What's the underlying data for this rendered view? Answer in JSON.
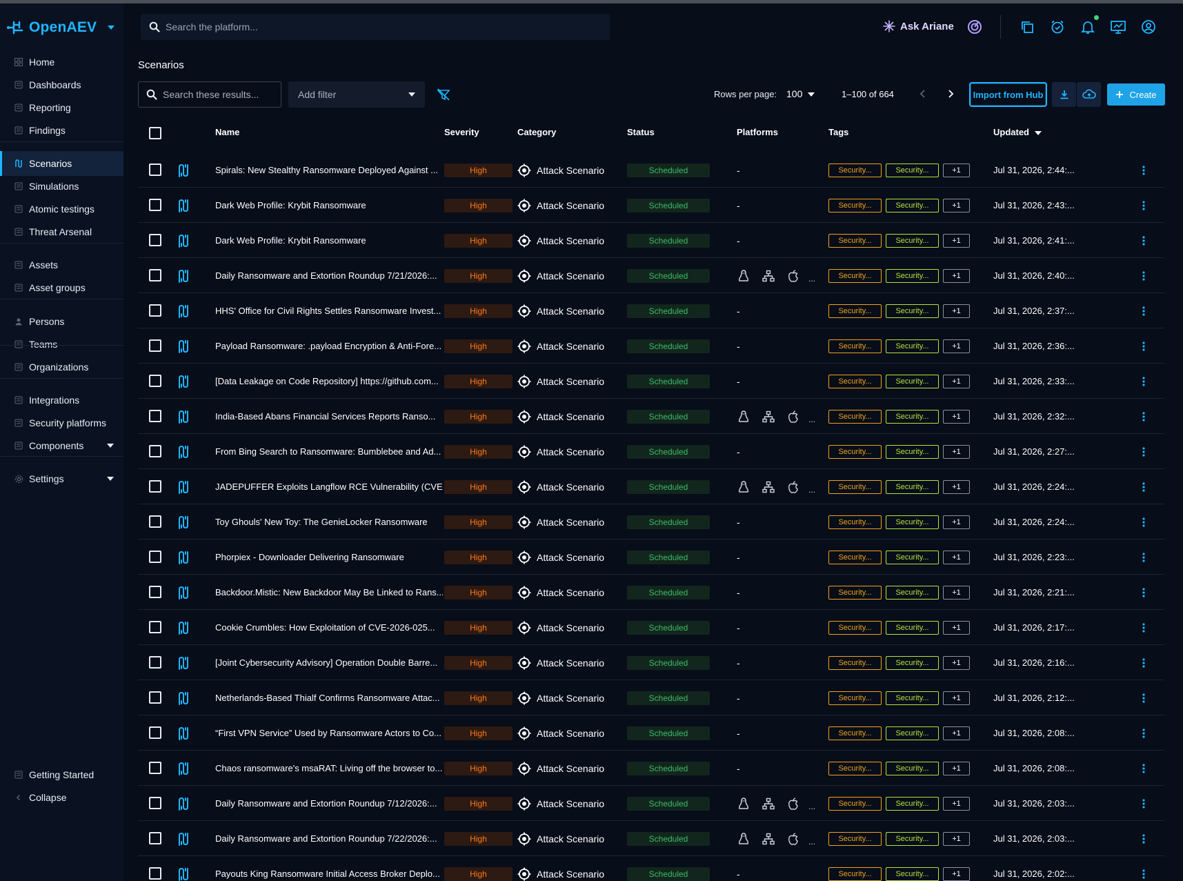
{
  "app": {
    "brand": "OpenAEV",
    "search_placeholder": "Search the platform...",
    "ask_ariane": "Ask Ariane"
  },
  "sidebar": {
    "items": [
      {
        "id": "home",
        "label": "Home",
        "icon": "home-icon"
      },
      {
        "id": "dashboards",
        "label": "Dashboards",
        "icon": "dashboard-icon"
      },
      {
        "id": "reporting",
        "label": "Reporting",
        "icon": "report-icon"
      },
      {
        "id": "findings",
        "label": "Findings",
        "icon": "findings-icon"
      },
      {
        "id": "scenarios",
        "label": "Scenarios",
        "icon": "scenario-icon",
        "active": true
      },
      {
        "id": "simulations",
        "label": "Simulations",
        "icon": "simulation-icon"
      },
      {
        "id": "atomic-testings",
        "label": "Atomic testings",
        "icon": "atomic-icon"
      },
      {
        "id": "threat-arsenal",
        "label": "Threat Arsenal",
        "icon": "arsenal-icon"
      },
      {
        "id": "assets",
        "label": "Assets",
        "icon": "assets-icon"
      },
      {
        "id": "asset-groups",
        "label": "Asset groups",
        "icon": "asset-groups-icon"
      },
      {
        "id": "persons",
        "label": "Persons",
        "icon": "person-icon"
      },
      {
        "id": "teams",
        "label": "Teams",
        "icon": "teams-icon"
      },
      {
        "id": "organizations",
        "label": "Organizations",
        "icon": "organization-icon"
      },
      {
        "id": "integrations",
        "label": "Integrations",
        "icon": "integrations-icon"
      },
      {
        "id": "security-platforms",
        "label": "Security platforms",
        "icon": "security-platform-icon"
      },
      {
        "id": "components",
        "label": "Components",
        "icon": "components-icon"
      },
      {
        "id": "settings",
        "label": "Settings",
        "icon": "settings-icon"
      },
      {
        "id": "getting-started",
        "label": "Getting Started",
        "icon": "rocket-icon"
      },
      {
        "id": "collapse",
        "label": "Collapse",
        "icon": "chevron-left-icon"
      }
    ]
  },
  "main": {
    "title": "Scenarios",
    "search_placeholder": "Search these results...",
    "add_filter": "Add filter",
    "rows_per_page_label": "Rows per page:",
    "rows_per_page": "100",
    "range": "1–100 of 664",
    "import_hub": "Import from Hub",
    "create": "Create"
  },
  "table": {
    "headers": {
      "name": "Name",
      "severity": "Severity",
      "category": "Category",
      "status": "Status",
      "platforms": "Platforms",
      "tags": "Tags",
      "updated": "Updated"
    },
    "tag_labels": {
      "tag1": "Security...",
      "tag2": "Security...",
      "more": "+1"
    },
    "rows": [
      {
        "name": "Spirals: New Stealthy Ransomware Deployed Against ...",
        "severity": "High",
        "category": "Attack Scenario",
        "status": "Scheduled",
        "platforms": "-",
        "updated": "Jul 31, 2026, 2:44:..."
      },
      {
        "name": "Dark Web Profile: Krybit Ransomware",
        "severity": "High",
        "category": "Attack Scenario",
        "status": "Scheduled",
        "platforms": "-",
        "updated": "Jul 31, 2026, 2:43:..."
      },
      {
        "name": "Dark Web Profile: Krybit Ransomware",
        "severity": "High",
        "category": "Attack Scenario",
        "status": "Scheduled",
        "platforms": "-",
        "updated": "Jul 31, 2026, 2:41:..."
      },
      {
        "name": "Daily Ransomware and Extortion Roundup 7/21/2026:...",
        "severity": "High",
        "category": "Attack Scenario",
        "status": "Scheduled",
        "platforms": "icons",
        "updated": "Jul 31, 2026, 2:40:..."
      },
      {
        "name": "HHS' Office for Civil Rights Settles Ransomware Invest...",
        "severity": "High",
        "category": "Attack Scenario",
        "status": "Scheduled",
        "platforms": "-",
        "updated": "Jul 31, 2026, 2:37:..."
      },
      {
        "name": "Payload Ransomware: .payload Encryption & Anti-Fore...",
        "severity": "High",
        "category": "Attack Scenario",
        "status": "Scheduled",
        "platforms": "-",
        "updated": "Jul 31, 2026, 2:36:..."
      },
      {
        "name": "[Data Leakage on Code Repository] https://github.com...",
        "severity": "High",
        "category": "Attack Scenario",
        "status": "Scheduled",
        "platforms": "-",
        "updated": "Jul 31, 2026, 2:33:..."
      },
      {
        "name": "India-Based Abans Financial Services Reports Ranso...",
        "severity": "High",
        "category": "Attack Scenario",
        "status": "Scheduled",
        "platforms": "icons",
        "updated": "Jul 31, 2026, 2:32:..."
      },
      {
        "name": "From Bing Search to Ransomware: Bumblebee and Ad...",
        "severity": "High",
        "category": "Attack Scenario",
        "status": "Scheduled",
        "platforms": "-",
        "updated": "Jul 31, 2026, 2:27:..."
      },
      {
        "name": "JADEPUFFER Exploits Langflow RCE Vulnerability (CVE...",
        "severity": "High",
        "category": "Attack Scenario",
        "status": "Scheduled",
        "platforms": "icons",
        "updated": "Jul 31, 2026, 2:24:..."
      },
      {
        "name": "Toy Ghouls' New Toy: The GenieLocker Ransomware",
        "severity": "High",
        "category": "Attack Scenario",
        "status": "Scheduled",
        "platforms": "-",
        "updated": "Jul 31, 2026, 2:24:..."
      },
      {
        "name": "Phorpiex - Downloader Delivering Ransomware",
        "severity": "High",
        "category": "Attack Scenario",
        "status": "Scheduled",
        "platforms": "-",
        "updated": "Jul 31, 2026, 2:23:..."
      },
      {
        "name": "Backdoor.Mistic: New Backdoor May Be Linked to Rans...",
        "severity": "High",
        "category": "Attack Scenario",
        "status": "Scheduled",
        "platforms": "-",
        "updated": "Jul 31, 2026, 2:21:..."
      },
      {
        "name": "Cookie Crumbles: How Exploitation of CVE-2026-025...",
        "severity": "High",
        "category": "Attack Scenario",
        "status": "Scheduled",
        "platforms": "-",
        "updated": "Jul 31, 2026, 2:17:..."
      },
      {
        "name": "[Joint Cybersecurity Advisory] Operation Double Barre...",
        "severity": "High",
        "category": "Attack Scenario",
        "status": "Scheduled",
        "platforms": "-",
        "updated": "Jul 31, 2026, 2:16:..."
      },
      {
        "name": "Netherlands-Based Thialf Confirms Ransomware Attac...",
        "severity": "High",
        "category": "Attack Scenario",
        "status": "Scheduled",
        "platforms": "-",
        "updated": "Jul 31, 2026, 2:12:..."
      },
      {
        "name": "“First VPN Service” Used by Ransomware Actors to Co...",
        "severity": "High",
        "category": "Attack Scenario",
        "status": "Scheduled",
        "platforms": "-",
        "updated": "Jul 31, 2026, 2:08:..."
      },
      {
        "name": "Chaos ransomware's msaRAT: Living off the browser to...",
        "severity": "High",
        "category": "Attack Scenario",
        "status": "Scheduled",
        "platforms": "-",
        "updated": "Jul 31, 2026, 2:08:..."
      },
      {
        "name": "Daily Ransomware and Extortion Roundup 7/12/2026:...",
        "severity": "High",
        "category": "Attack Scenario",
        "status": "Scheduled",
        "platforms": "icons",
        "updated": "Jul 31, 2026, 2:03:..."
      },
      {
        "name": "Daily Ransomware and Extortion Roundup 7/22/2026:...",
        "severity": "High",
        "category": "Attack Scenario",
        "status": "Scheduled",
        "platforms": "icons",
        "updated": "Jul 31, 2026, 2:03:..."
      },
      {
        "name": "Payouts King Ransomware Initial Access Broker Deplo...",
        "severity": "High",
        "category": "Attack Scenario",
        "status": "Scheduled",
        "platforms": "-",
        "updated": "Jul 31, 2026, 2:02:..."
      }
    ]
  },
  "colors": {
    "accent": "#1fb6ff",
    "severity_high": "#ff7a1a",
    "status_scheduled": "#3dbb6a",
    "tag_orange": "#f0a31a",
    "tag_lime": "#b7e53a"
  }
}
